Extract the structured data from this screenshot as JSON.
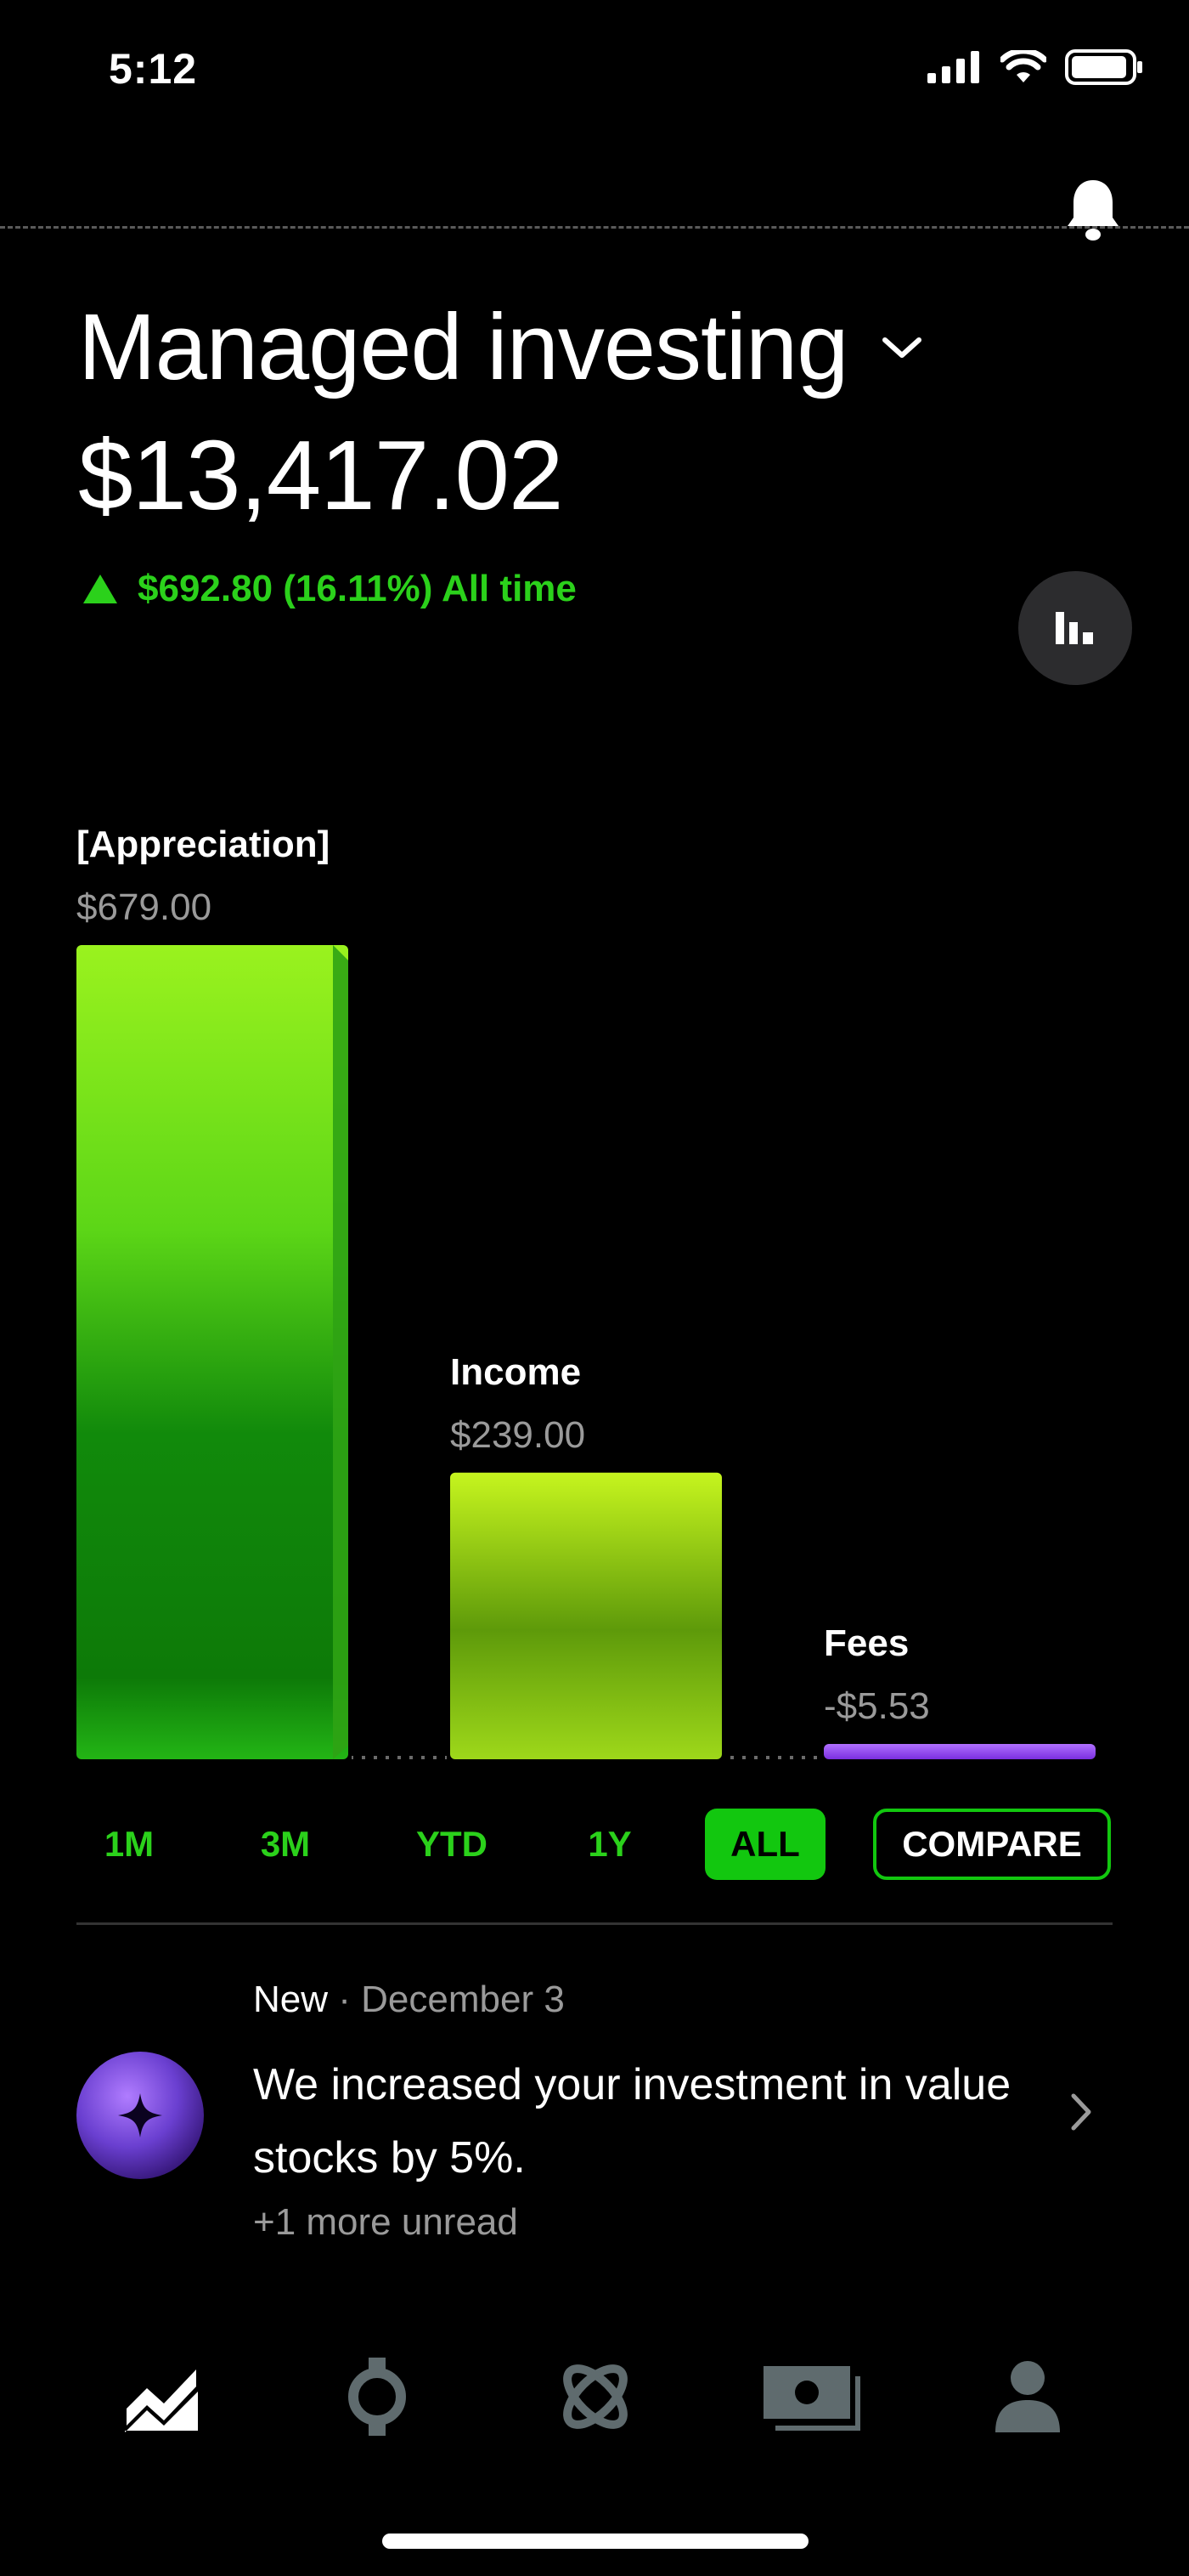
{
  "status_bar": {
    "time": "5:12"
  },
  "header": {
    "title": "Managed investing",
    "balance": "$13,417.02",
    "gain": "$692.80 (16.11%) All time"
  },
  "chart_data": {
    "type": "bar",
    "categories": [
      "[Appreciation]",
      "Income",
      "Fees"
    ],
    "values": [
      679.0,
      239.0,
      -5.53
    ],
    "value_labels": [
      "$679.00",
      "$239.00",
      "-$5.53"
    ],
    "colors": [
      "#7ee81a",
      "#b8f01a",
      "#9b4dff"
    ]
  },
  "ranges": [
    "1M",
    "3M",
    "YTD",
    "1Y",
    "ALL"
  ],
  "active_range": "ALL",
  "compare_label": "COMPARE",
  "notification": {
    "badge": "New",
    "date": "December 3",
    "text": "We increased your investment in value stocks by 5%.",
    "more": "+1 more unread"
  },
  "tabbar": {
    "icons": [
      "performance-icon",
      "portfolio-icon",
      "discover-icon",
      "cash-icon",
      "profile-icon"
    ]
  }
}
